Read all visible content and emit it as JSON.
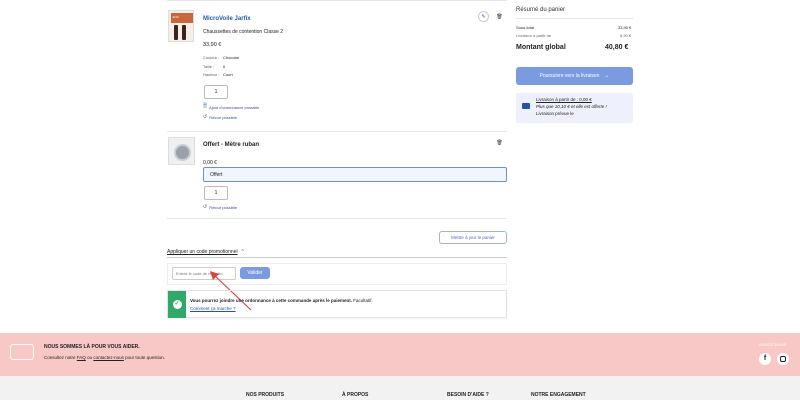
{
  "cart": {
    "items": [
      {
        "title": "MicroVoile Jarfix",
        "subtitle": "Chaussettes de contention Classe 2",
        "price": "33,90 €",
        "attributes": [
          {
            "label": "Couleur :",
            "value": "Chocolat"
          },
          {
            "label": "Taille :",
            "value": "II"
          },
          {
            "label": "Hauteur :",
            "value": "Court"
          }
        ],
        "qty": "1",
        "prescription_link": "Ajout d'ordonnance possible",
        "return_text": "Retour possible",
        "thumb_text": "Jarfix"
      },
      {
        "title": "Offert - Mètre ruban",
        "price": "0,00 €",
        "select_value": "Offert",
        "qty": "1",
        "return_text": "Retour possible"
      }
    ],
    "update_button": "Mettre à jour le panier",
    "promo_toggle": "Appliquer un code promotionnel",
    "promo_placeholder": "Entrez le code de réductio",
    "promo_button": "Valider",
    "notice_bold": "Vous pourrez joindre une ordonnance à cette commande après le paiement.",
    "notice_optional": "Facultatif.",
    "notice_link": "Comment ça marche ?"
  },
  "summary": {
    "title": "Résumé du panier",
    "subtotal_label": "Sous-total",
    "subtotal_value": "33,90 €",
    "shipping_label": "Livraison à partir de",
    "shipping_value": "6,90 €",
    "total_label": "Montant global",
    "total_value": "40,80 €",
    "checkout_button": "Poursuivre vers la livraison",
    "delivery_line1": "Livraison à partir de : 0,00 €",
    "delivery_line2": "Plus que 10,10 € et elle est offerte !",
    "delivery_line3": "Livraison prévue le"
  },
  "help": {
    "heading": "NOUS SOMMES LÀ POUR VOUS AIDER.",
    "text_before": "Consultez notre",
    "faq": "FAQ",
    "text_mid": "ou",
    "contact": "contactez-nous",
    "text_after": "pour toute question.",
    "follow": "SUIVEZ-NOUS"
  },
  "footer": {
    "columns": [
      "NOS PRODUITS",
      "À PROPOS",
      "BESOIN D'AIDE ?",
      "NOTRE ENGAGEMENT"
    ]
  },
  "colors": {
    "accent": "#7a9be0",
    "help_bg": "#f8c8c7",
    "notice_green": "#2fa86a",
    "annotation_red": "#d8443c"
  }
}
